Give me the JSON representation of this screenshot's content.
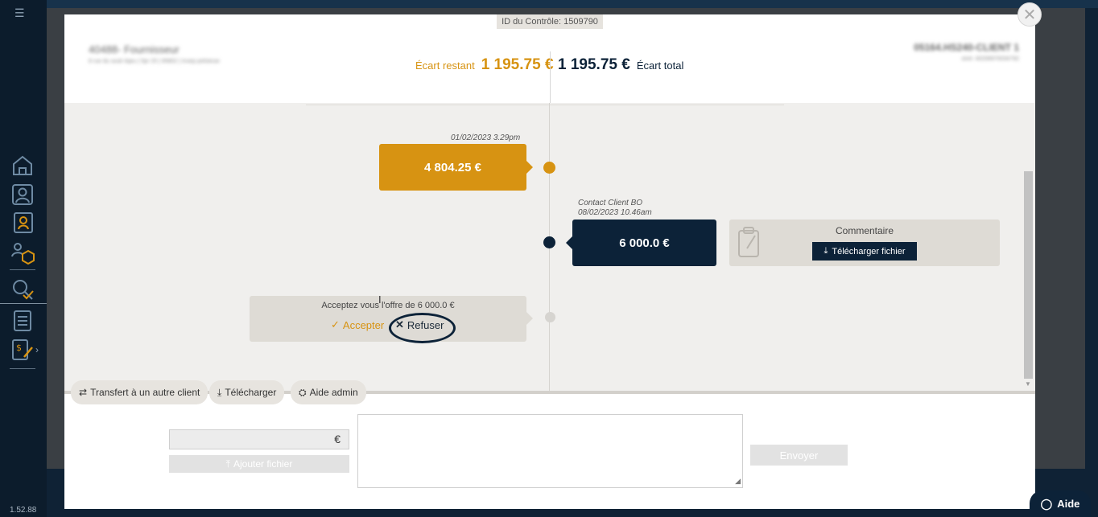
{
  "app": {
    "version": "1.52.88",
    "accent_orange": "#d79312",
    "accent_navy": "#0c2238"
  },
  "sidebar": {
    "items": [
      {
        "name": "home-icon"
      },
      {
        "name": "user-icon"
      },
      {
        "name": "contacts-icon"
      },
      {
        "name": "supplier-box-icon"
      },
      {
        "name": "search-check-icon"
      },
      {
        "name": "list-icon"
      },
      {
        "name": "invoice-edit-icon"
      }
    ]
  },
  "modal": {
    "id_label": "ID du Contrôle: 1509790",
    "supplier_name": "40488- Fournisseur",
    "supplier_address": "8 rue du souk tiqeu | 5pr 25 | 95802 | Inxep pelsteuw",
    "client_name": "05164.HS240-CLIENT 1",
    "client_sub": "siret: 40208970034792",
    "ecart_restant_label": "Écart restant",
    "ecart_restant_value": "1 195.75 €",
    "ecart_total_value": "1 195.75 €",
    "ecart_total_label": "Écart total"
  },
  "timeline": {
    "entry1": {
      "timestamp": "01/02/2023 3.29pm",
      "amount": "4 804.25 €"
    },
    "entry2": {
      "author": "Contact Client BO",
      "timestamp": "08/02/2023 10.46am",
      "amount": "6 000.0 €"
    },
    "comment": {
      "title": "Commentaire",
      "download_label": "Télécharger fichier"
    },
    "offer": {
      "question": "Acceptez vous l'offre de 6 000.0 €",
      "accept_label": "Accepter",
      "refuse_label": "Refuser"
    }
  },
  "actions": {
    "transfer_label": "Transfert à un autre client",
    "download_label": "Télécharger",
    "admin_label": "Aide admin"
  },
  "compose": {
    "currency": "€",
    "add_file_label": "Ajouter fichier",
    "send_label": "Envoyer"
  },
  "help": {
    "label": "Aide"
  }
}
